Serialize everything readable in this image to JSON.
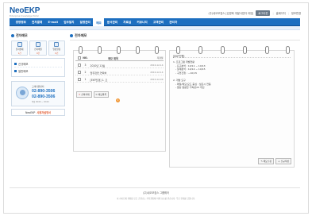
{
  "header": {
    "logo": "NeoEKP",
    "logo_sub": "Enterprise Knowledge Portal",
    "user_text": "(주)네오모침스 [김영희 개발사업자 과장]",
    "logout_label": "로그아웃",
    "home_label": "홈페이지",
    "info_label": "정보변경"
  },
  "nav": {
    "items": [
      {
        "label": "경영정보",
        "active": false
      },
      {
        "label": "전자결재",
        "active": false
      },
      {
        "label": "E-mail",
        "active": false
      },
      {
        "label": "업무일지",
        "active": false
      },
      {
        "label": "일정관리",
        "active": false
      },
      {
        "label": "메모",
        "active": true
      },
      {
        "label": "문서관리",
        "active": false
      },
      {
        "label": "자료실",
        "active": false
      },
      {
        "label": "커뮤니티",
        "active": false
      },
      {
        "label": "고객관리",
        "active": false
      },
      {
        "label": "관리자",
        "active": false
      }
    ]
  },
  "sidebar": {
    "title": "전자메모",
    "icons": [
      {
        "label": "전자결재",
        "count": "1건"
      },
      {
        "label": "전자메일",
        "count": "0건"
      },
      {
        "label": "일정알림",
        "count": "0건"
      }
    ],
    "menu": [
      {
        "label": "신규메모"
      },
      {
        "label": "일반메모"
      }
    ],
    "help": {
      "title": "고객지원센터",
      "phone1": "02-890-3506",
      "phone2": "02-890-3506",
      "hours": "평일 09:00 ~ 18:00"
    },
    "manual": {
      "brand": "NeoEKP",
      "label": "사용자설명서"
    }
  },
  "main": {
    "title": "전자메모",
    "table": {
      "headers": {
        "no": "NO.",
        "title": "메모 제목",
        "date": "저장일"
      },
      "rows": [
        {
          "no": "3",
          "title": "2010년 11월",
          "date": "2010-12-14"
        },
        {
          "no": "2",
          "title": "업무관련 연락처",
          "date": "2010-12-14"
        },
        {
          "no": "1",
          "title": "[EKP진행] 1. 프",
          "date": "2010-12-09"
        }
      ],
      "delete_label": "선택삭제",
      "reset_label": "메모목록",
      "page": "1"
    },
    "memo": {
      "header": "[EKP진행]",
      "body": "1. 프로그램 개발현황\n   - 요구분석 : 10/11 ~ 10/13\n   - 설계분석 : 10/14 ~ 10/15\n   - 구현진행 : ~10/15\n\n2. 개발 요구\n   - 메일/메모/모드 중심 : 필요시 연동\n   - 웹상 원활한 가독성/UI 개선",
      "edit_label": "메모수정",
      "new_label": "신규작성"
    }
  },
  "footer": {
    "company": "(주)네오모침스 그룹웨어",
    "notice": "이 사이트에 게재된 모든 콘텐츠는 저작권법에 의해 보호를 받습니다. 무단 전재를 금합니다."
  }
}
